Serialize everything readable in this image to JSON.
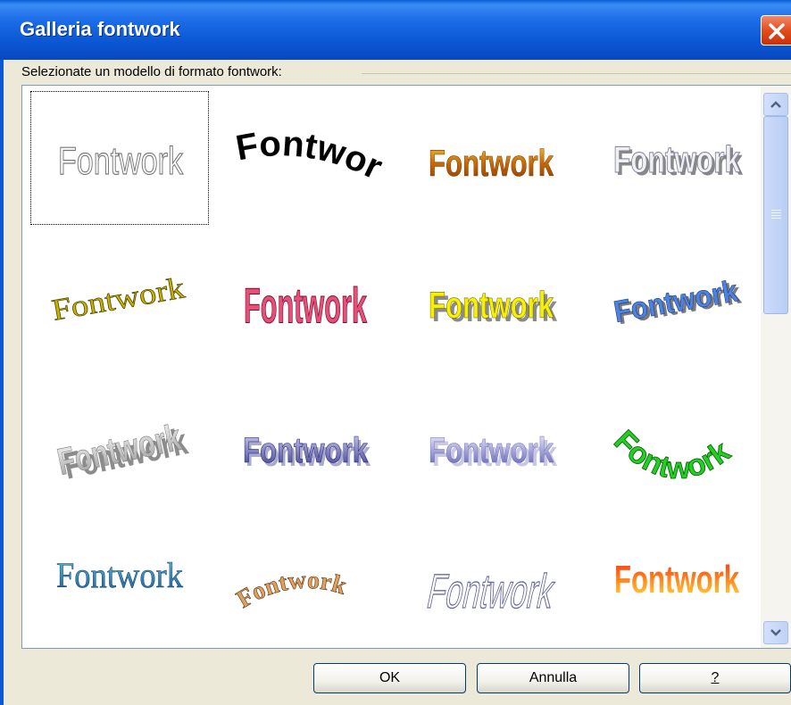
{
  "window": {
    "title": "Galleria fontwork"
  },
  "group": {
    "label": "Selezionate un modello di formato fontwork:"
  },
  "gallery": {
    "items": [
      {
        "text": "Fontwork",
        "selected": true
      },
      {
        "text": "Fontwork"
      },
      {
        "text": "Fontwork"
      },
      {
        "text": "Fontwork"
      },
      {
        "text": "Fontwork"
      },
      {
        "text": "Fontwork"
      },
      {
        "text": "Fontwork"
      },
      {
        "text": "Fontwork"
      },
      {
        "text": "Fontwork"
      },
      {
        "text": "Fontwork"
      },
      {
        "text": "Fontwork"
      },
      {
        "text": "Fontwork"
      },
      {
        "text": "Fontwork"
      },
      {
        "text": "Fontwork"
      },
      {
        "text": "Fontwork"
      },
      {
        "text": "Fontwork"
      }
    ]
  },
  "buttons": {
    "ok": "OK",
    "cancel": "Annulla",
    "help": "?"
  },
  "colors": {
    "titlebar": "#0b57d4",
    "close": "#e24d1e",
    "selection": "#000000"
  }
}
